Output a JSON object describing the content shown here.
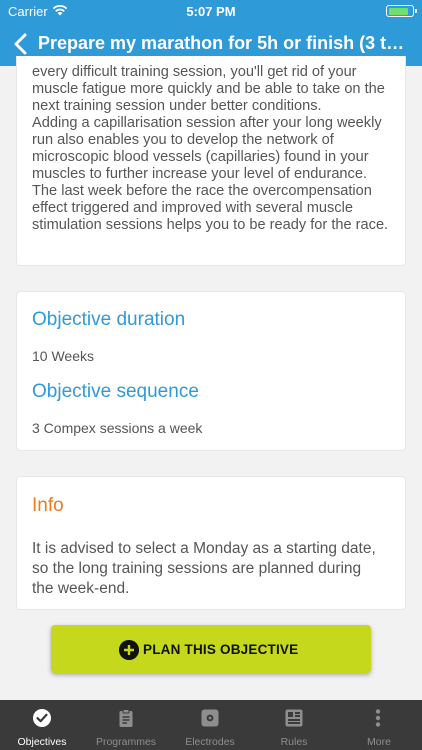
{
  "status_bar": {
    "carrier": "Carrier",
    "time": "5:07 PM",
    "battery_level": 0.9
  },
  "nav": {
    "title": "Prepare my marathon for 5h or finish (3 trai..."
  },
  "description": {
    "text": "every difficult training session, you'll get rid of your muscle fatigue more quickly and be able to take on the next training session under better conditions.\nAdding a capillarisation session after your long weekly run also enables you to develop the network of microscopic blood vessels (capillaries) found in your muscles to further increase your level of endurance.\nThe last week before the race the overcompensation effect triggered and improved with several muscle stimulation sessions helps you to be ready for the race."
  },
  "objective": {
    "duration_title": "Objective duration",
    "duration_value": "10 Weeks",
    "sequence_title": "Objective sequence",
    "sequence_value": "3 Compex sessions a week"
  },
  "info": {
    "title": "Info",
    "text": "It is advised to select a Monday as a starting date, so the long training sessions are planned during the week-end."
  },
  "plan_button": {
    "label": "PLAN THIS OBJECTIVE",
    "color": "#c5d81b"
  },
  "tabs": [
    {
      "label": "Objectives",
      "icon": "check-circle-icon",
      "active": true
    },
    {
      "label": "Programmes",
      "icon": "clipboard-icon",
      "active": false
    },
    {
      "label": "Electrodes",
      "icon": "electrode-icon",
      "active": false
    },
    {
      "label": "Rules",
      "icon": "rules-icon",
      "active": false
    },
    {
      "label": "More",
      "icon": "more-icon",
      "active": false
    }
  ],
  "colors": {
    "header": "#2f9ad8",
    "section_title": "#2f9ad8",
    "info_title": "#f07a1c",
    "tab_bar": "#3a3a3a"
  }
}
